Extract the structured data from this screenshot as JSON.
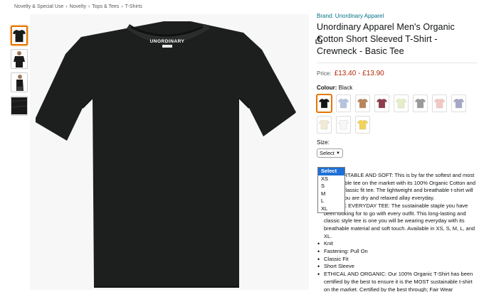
{
  "breadcrumb": [
    "Novelty & Special Use",
    "Novelty",
    "Tops & Tees",
    "T-Shirts"
  ],
  "breadcrumb_separator": "›",
  "thumbnails": [
    {
      "name": "front",
      "color": "#1a1a1a"
    },
    {
      "name": "model-front",
      "color": "#1a1a1a"
    },
    {
      "name": "model-side",
      "color": "#1a1a1a"
    },
    {
      "name": "fabric-detail",
      "color": "#1a1a1a"
    }
  ],
  "main_image": {
    "label": "UNORDINARY",
    "shirt_color": "#1c1f1e"
  },
  "product": {
    "brand": "Brand: Unordinary Apparel",
    "title": "Unordinary Apparel Men's Organic Cotton Short Sleeved T-Shirt - Crewneck - Basic Tee",
    "price_label": "Price:",
    "price": "£13.40 - £13.90",
    "colour_label": "Colour:",
    "colour_value": "Black"
  },
  "swatches": [
    {
      "name": "black",
      "color": "#141414"
    },
    {
      "name": "light-blue",
      "color": "#b6c3e0"
    },
    {
      "name": "camel",
      "color": "#b98457"
    },
    {
      "name": "burgundy",
      "color": "#8e3b4c"
    },
    {
      "name": "pale-green",
      "color": "#e4efc6"
    },
    {
      "name": "grey",
      "color": "#9a9a9a"
    },
    {
      "name": "pink",
      "color": "#f3c7c2"
    },
    {
      "name": "lavender",
      "color": "#a4a8c4"
    },
    {
      "name": "cream",
      "color": "#f2ead4"
    },
    {
      "name": "white",
      "color": "#f8f8f8"
    },
    {
      "name": "yellow",
      "color": "#f2d35a"
    }
  ],
  "size": {
    "label": "Size:",
    "selected": "Select",
    "options": [
      "Select",
      "XS",
      "S",
      "M",
      "L",
      "XL"
    ]
  },
  "bullets": [
    "COMFORTABLE AND SOFT: This is by far the softest and most comfortable tee on the market with its 100% Organic Cotton and relaxed classic fit tee. The lightweight and breathable t-shirt will ensure you are dry and relaxed allay everyday.",
    "CLASSIC EVERYDAY TEE: The sustainable staple you have been looking for to go with every outfit. This long-lasting and classic style tee is one you will be wearing everyday with its breathable material and soft touch. Available in XS, S, M, L, and XL.",
    "Knit",
    "Fastening: Pull On",
    "Classic Fit",
    "Short Sleeve",
    "ETHICAL AND ORGANIC: Our 100% Organic T-Shirt has been certified by the best to ensure it is the MOST sustainable t-shirt on the market. Certified by the best through; Fair Wear Foundation (All workers are treated and paid fairly), PETA"
  ]
}
